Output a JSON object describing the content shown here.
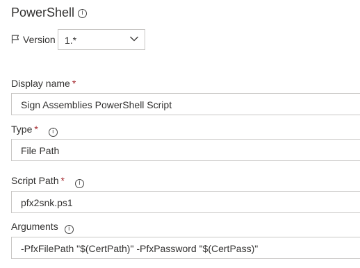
{
  "header": {
    "title": "PowerShell",
    "info_icon": "info-icon"
  },
  "version": {
    "label": "Version",
    "value": "1.*",
    "flag_icon": "flag-icon",
    "dropdown_icon": "chevron-down-icon"
  },
  "fields": {
    "display_name": {
      "label": "Display name",
      "required_mark": "*",
      "value": "Sign Assemblies PowerShell Script"
    },
    "type": {
      "label": "Type",
      "required_mark": "*",
      "value": "File Path"
    },
    "script_path": {
      "label": "Script Path",
      "required_mark": "*",
      "value": "pfx2snk.ps1"
    },
    "arguments": {
      "label": "Arguments",
      "value": "-PfxFilePath \"$(CertPath)\" -PfxPassword \"$(CertPass)\""
    }
  },
  "colors": {
    "required": "#a4262c",
    "border": "#c8c6c4",
    "text": "#323130"
  }
}
